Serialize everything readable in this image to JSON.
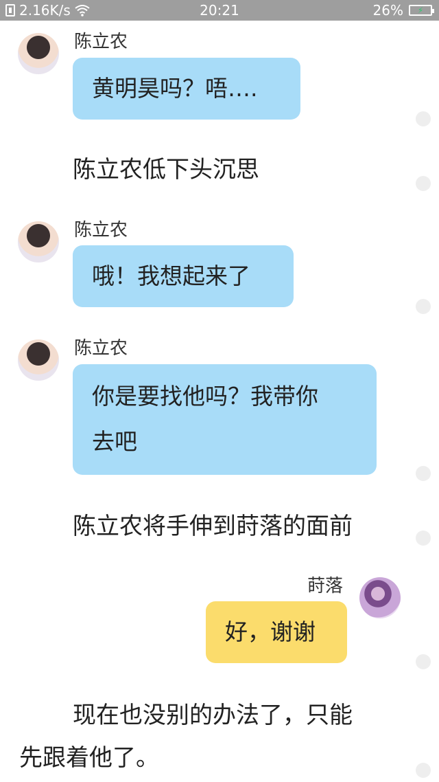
{
  "status_bar": {
    "network_speed": "2.16K/s",
    "time": "20:21",
    "battery_percent": "26%"
  },
  "messages": [
    {
      "type": "message",
      "sender": "陈立农",
      "text": "黄明昊吗？唔…."
    },
    {
      "type": "narration",
      "text": "陈立农低下头沉思"
    },
    {
      "type": "message",
      "sender": "陈立农",
      "text": "哦！我想起来了"
    },
    {
      "type": "message",
      "sender": "陈立农",
      "line1": "你是要找他吗？我带你",
      "line2": "去吧"
    },
    {
      "type": "narration",
      "text": "陈立农将手伸到莳落的面前"
    },
    {
      "type": "message",
      "sender": "莳落",
      "text": "好，谢谢"
    },
    {
      "type": "narration",
      "line1": "现在也没别的办法了，只能",
      "line2": "先跟着他了。"
    }
  ],
  "colors": {
    "status_bar_bg": "#9e9e9e",
    "left_bubble": "#a8dcf8",
    "right_bubble": "#fbdc6c",
    "dot": "#eeeeee"
  }
}
